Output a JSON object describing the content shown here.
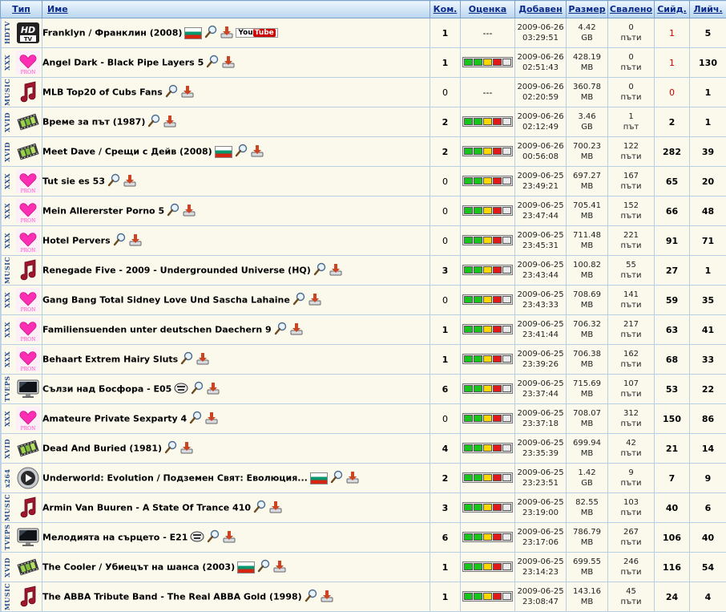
{
  "headers": {
    "type": "Тип",
    "name": "Име",
    "comments": "Ком.",
    "rating": "Оценка",
    "added": "Добавен",
    "size": "Размер",
    "downloaded": "Свалено",
    "seeders": "Сийд.",
    "leechers": "Лийч."
  },
  "colors": {
    "r0": "#e31919",
    "r1": "#ffd800",
    "r2": "#19c41e",
    "empty": "#e9e9e9"
  },
  "rows": [
    {
      "cat": "HDTV",
      "icon": "hd-tv-icon",
      "name": "Franklyn / Франклин (2008)",
      "flag": true,
      "youtube": true,
      "yt1": "You",
      "yt2": "Tube",
      "comments": "1",
      "rating": "---",
      "date": "2009-06-26",
      "time": "03:29:51",
      "size": "4.42",
      "unit": "GB",
      "dl": "0",
      "dlu": "пъти",
      "seed": "1",
      "seedRed": true,
      "leech": "5"
    },
    {
      "cat": "XXX",
      "icon": "heart-icon",
      "name": "Angel Dark - Black Pipe Layers 5",
      "comments": "1",
      "rating": "bars",
      "date": "2009-06-26",
      "time": "02:51:43",
      "size": "428.19",
      "unit": "MB",
      "dl": "0",
      "dlu": "пъти",
      "seed": "1",
      "seedRed": true,
      "leech": "130"
    },
    {
      "cat": "MUSIC",
      "icon": "music-note-icon",
      "name": "MLB Top20 of Cubs Fans",
      "comments": "0",
      "rating": "---",
      "date": "2009-06-26",
      "time": "02:20:59",
      "size": "360.78",
      "unit": "MB",
      "dl": "0",
      "dlu": "пъти",
      "seed": "0",
      "seedRed": true,
      "leech": "1"
    },
    {
      "cat": "XVID",
      "icon": "film-icon",
      "name": "Време за път (1987)",
      "comments": "2",
      "rating": "bars",
      "date": "2009-06-26",
      "time": "02:12:49",
      "size": "3.46",
      "unit": "GB",
      "dl": "1",
      "dlu": "път",
      "seed": "2",
      "leech": "1"
    },
    {
      "cat": "XVID",
      "icon": "film-icon",
      "name": "Meet Dave / Срещи с Дейв (2008)",
      "flag": true,
      "comments": "2",
      "rating": "bars",
      "date": "2009-06-26",
      "time": "00:56:08",
      "size": "700.23",
      "unit": "MB",
      "dl": "122",
      "dlu": "пъти",
      "seed": "282",
      "leech": "39"
    },
    {
      "cat": "XXX",
      "icon": "heart-icon",
      "name": "Tut sie es 53",
      "comments": "0",
      "rating": "bars",
      "date": "2009-06-25",
      "time": "23:49:21",
      "size": "697.27",
      "unit": "MB",
      "dl": "167",
      "dlu": "пъти",
      "seed": "65",
      "leech": "20"
    },
    {
      "cat": "XXX",
      "icon": "heart-icon",
      "name": "Mein Allererster Porno 5",
      "comments": "0",
      "rating": "bars",
      "date": "2009-06-25",
      "time": "23:47:44",
      "size": "705.41",
      "unit": "MB",
      "dl": "152",
      "dlu": "пъти",
      "seed": "66",
      "leech": "48"
    },
    {
      "cat": "XXX",
      "icon": "heart-icon",
      "name": "Hotel Pervers",
      "comments": "0",
      "rating": "bars",
      "date": "2009-06-25",
      "time": "23:45:31",
      "size": "711.48",
      "unit": "MB",
      "dl": "221",
      "dlu": "пъти",
      "seed": "91",
      "leech": "71"
    },
    {
      "cat": "MUSIC",
      "icon": "music-note-icon",
      "name": "Renegade Five - 2009 - Undergrounded Universe (HQ)",
      "comments": "3",
      "rating": "bars",
      "date": "2009-06-25",
      "time": "23:43:44",
      "size": "100.82",
      "unit": "MB",
      "dl": "55",
      "dlu": "пъти",
      "seed": "27",
      "leech": "1"
    },
    {
      "cat": "XXX",
      "icon": "heart-icon",
      "name": "Gang Bang Total Sidney Love Und Sascha Lahaine",
      "comments": "0",
      "rating": "bars",
      "date": "2009-06-25",
      "time": "23:43:33",
      "size": "708.69",
      "unit": "MB",
      "dl": "141",
      "dlu": "пъти",
      "seed": "59",
      "leech": "35"
    },
    {
      "cat": "XXX",
      "icon": "heart-icon",
      "name": "Familiensuenden unter deutschen Daechern 9",
      "comments": "1",
      "rating": "bars",
      "date": "2009-06-25",
      "time": "23:41:44",
      "size": "706.32",
      "unit": "MB",
      "dl": "217",
      "dlu": "пъти",
      "seed": "63",
      "leech": "41"
    },
    {
      "cat": "XXX",
      "icon": "heart-icon",
      "name": "Behaart Extrem Hairy Sluts",
      "comments": "1",
      "rating": "bars",
      "date": "2009-06-25",
      "time": "23:39:26",
      "size": "706.38",
      "unit": "MB",
      "dl": "162",
      "dlu": "пъти",
      "seed": "68",
      "leech": "33"
    },
    {
      "cat": "TVEPS",
      "icon": "monitor-icon",
      "name": "Сълзи над Босфора - E05",
      "subs": true,
      "comments": "6",
      "rating": "bars",
      "date": "2009-06-25",
      "time": "23:37:44",
      "size": "715.69",
      "unit": "MB",
      "dl": "107",
      "dlu": "пъти",
      "seed": "53",
      "leech": "22"
    },
    {
      "cat": "XXX",
      "icon": "heart-icon",
      "name": "Amateure Private Sexparty 4",
      "comments": "0",
      "rating": "bars",
      "date": "2009-06-25",
      "time": "23:37:18",
      "size": "708.07",
      "unit": "MB",
      "dl": "312",
      "dlu": "пъти",
      "seed": "150",
      "leech": "86"
    },
    {
      "cat": "XVID",
      "icon": "film-icon",
      "name": "Dead And Buried (1981)",
      "comments": "4",
      "rating": "bars",
      "date": "2009-06-25",
      "time": "23:35:39",
      "size": "699.94",
      "unit": "MB",
      "dl": "42",
      "dlu": "пъти",
      "seed": "21",
      "leech": "14"
    },
    {
      "cat": "x264",
      "icon": "play-disc-icon",
      "name": "Underworld: Evolution / Подземен Свят: Еволюция...",
      "flag": true,
      "comments": "2",
      "rating": "bars",
      "date": "2009-06-25",
      "time": "23:23:51",
      "size": "1.42",
      "unit": "GB",
      "dl": "9",
      "dlu": "пъти",
      "seed": "7",
      "leech": "9"
    },
    {
      "cat": "MUSIC",
      "icon": "music-note-icon",
      "name": "Armin Van Buuren - A State Of Trance 410",
      "comments": "3",
      "rating": "bars",
      "date": "2009-06-25",
      "time": "23:19:00",
      "size": "82.55",
      "unit": "MB",
      "dl": "103",
      "dlu": "пъти",
      "seed": "40",
      "leech": "6"
    },
    {
      "cat": "TVEPS",
      "icon": "monitor-icon",
      "name": "Мелодията на сърцето - E21",
      "subs": true,
      "comments": "6",
      "rating": "bars",
      "date": "2009-06-25",
      "time": "23:17:06",
      "size": "786.79",
      "unit": "MB",
      "dl": "267",
      "dlu": "пъти",
      "seed": "106",
      "leech": "40"
    },
    {
      "cat": "XVID",
      "icon": "film-icon",
      "name": "The Cooler / Убиецът на шанса (2003)",
      "flag": true,
      "comments": "1",
      "rating": "bars",
      "date": "2009-06-25",
      "time": "23:14:23",
      "size": "699.55",
      "unit": "MB",
      "dl": "246",
      "dlu": "пъти",
      "seed": "116",
      "leech": "54"
    },
    {
      "cat": "MUSIC",
      "icon": "music-note-icon",
      "name": "The ABBA Tribute Band - The Real ABBA Gold (1998)",
      "comments": "1",
      "rating": "bars",
      "date": "2009-06-25",
      "time": "23:08:47",
      "size": "143.16",
      "unit": "MB",
      "dl": "45",
      "dlu": "пъти",
      "seed": "24",
      "leech": "4"
    }
  ]
}
